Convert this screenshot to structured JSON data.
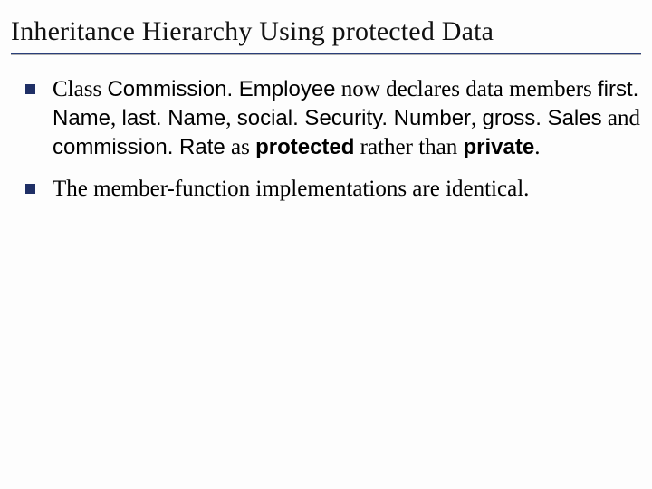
{
  "title": "Inheritance Hierarchy Using protected Data",
  "bullets": [
    {
      "segments": [
        {
          "t": "Class "
        },
        {
          "t": "Commission. Employee",
          "cls": "code"
        },
        {
          "t": " now declares data members "
        },
        {
          "t": "first. Name",
          "cls": "code"
        },
        {
          "t": ", "
        },
        {
          "t": "last. Name",
          "cls": "code"
        },
        {
          "t": ", "
        },
        {
          "t": "social. Security. Number",
          "cls": "code"
        },
        {
          "t": ", "
        },
        {
          "t": "gross. Sales",
          "cls": "code"
        },
        {
          "t": " and "
        },
        {
          "t": "commission. Rate",
          "cls": "code"
        },
        {
          "t": " as "
        },
        {
          "t": "protected",
          "cls": "kw"
        },
        {
          "t": " rather than "
        },
        {
          "t": "private",
          "cls": "kw"
        },
        {
          "t": "."
        }
      ]
    },
    {
      "segments": [
        {
          "t": "The member-function implementations are identical."
        }
      ]
    }
  ]
}
